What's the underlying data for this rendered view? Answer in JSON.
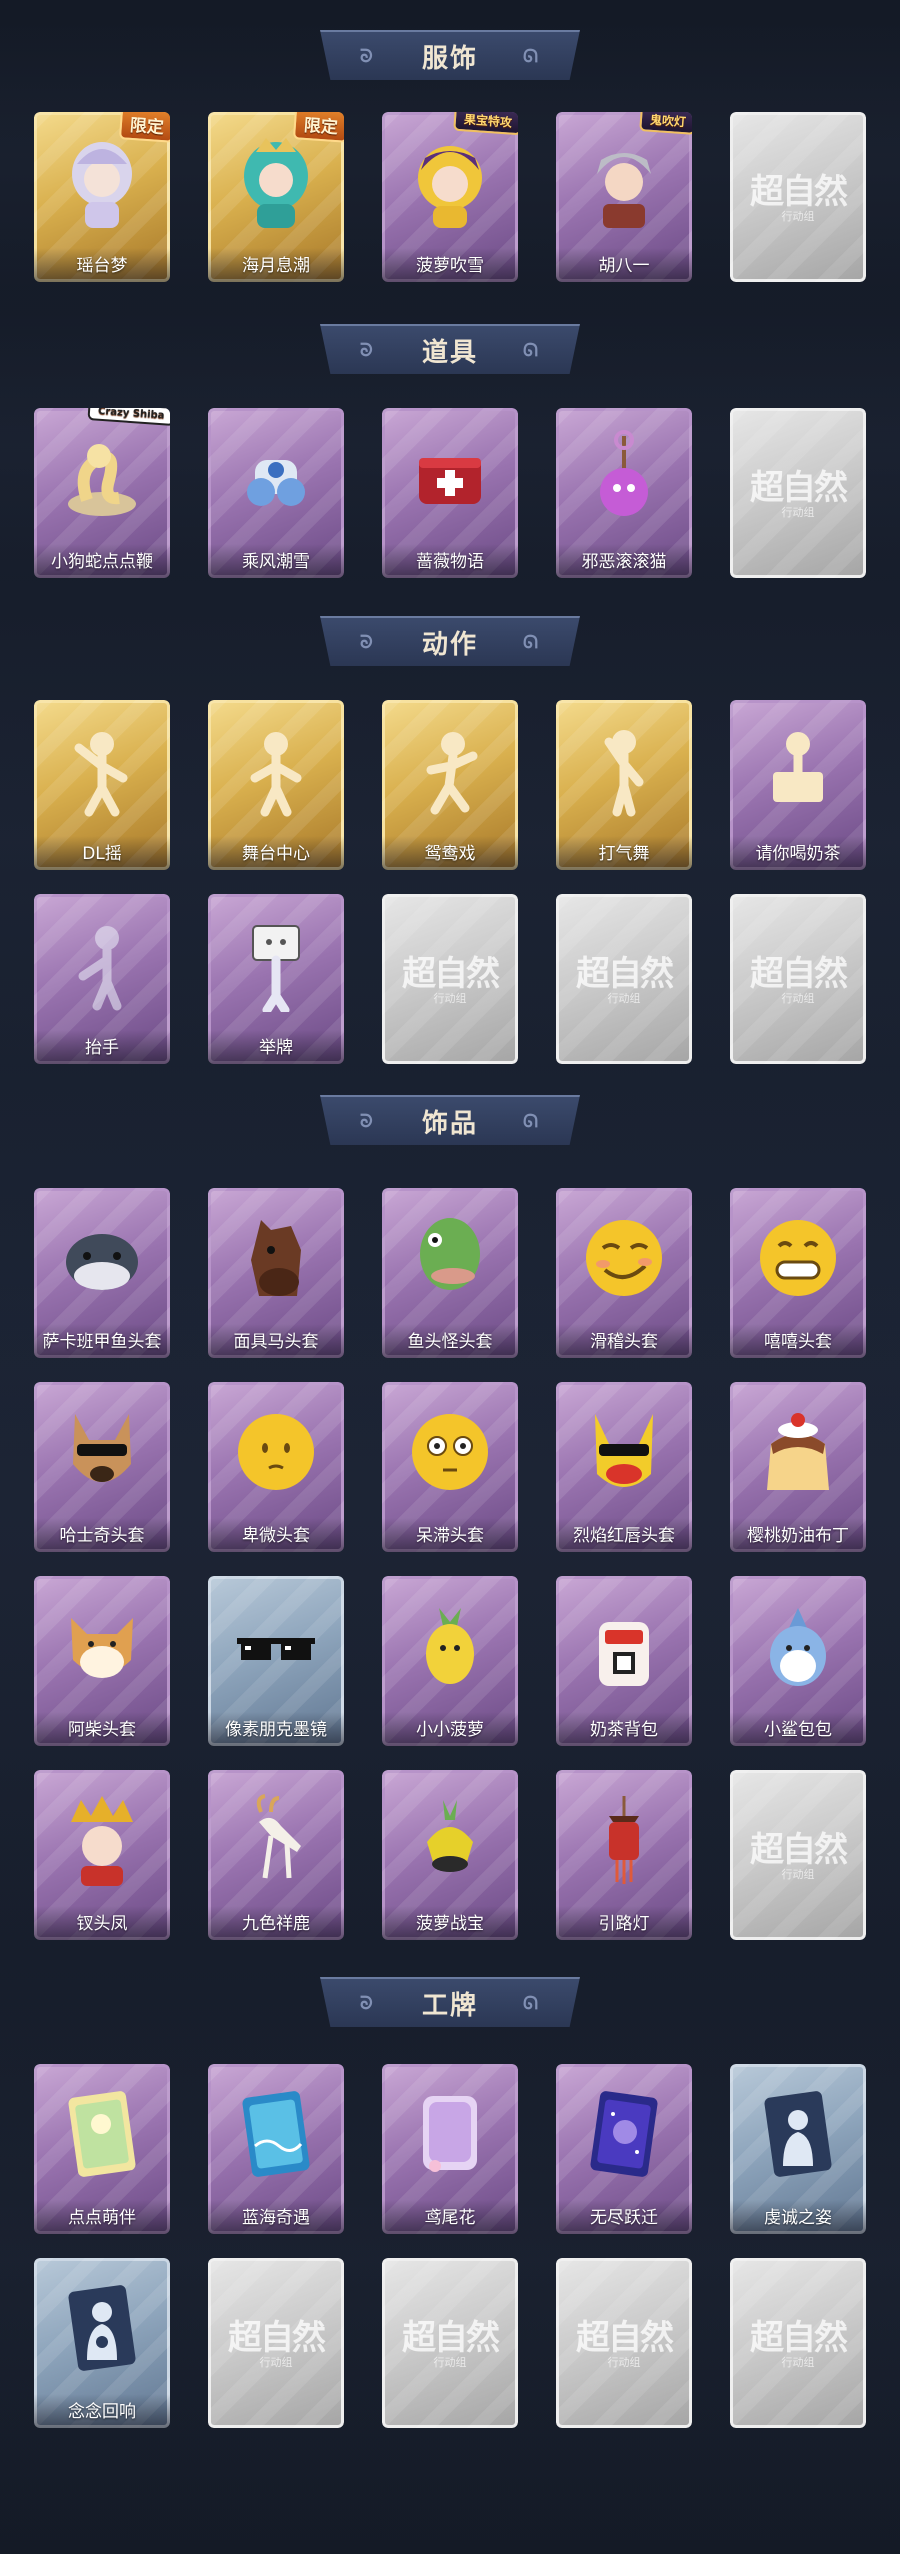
{
  "sections": {
    "costume": {
      "title": "服饰",
      "items": [
        {
          "label": "瑶台梦",
          "badge": "限定"
        },
        {
          "label": "海月息潮",
          "badge": "限定"
        },
        {
          "label": "菠萝吹雪",
          "badge": "果宝特攻"
        },
        {
          "label": "胡八一",
          "badge": "鬼吹灯"
        },
        {
          "label": ""
        }
      ]
    },
    "props": {
      "title": "道具",
      "items": [
        {
          "label": "小狗蛇点点鞭",
          "badge": "Crazy Shiba"
        },
        {
          "label": "乘风潮雪"
        },
        {
          "label": "蔷薇物语"
        },
        {
          "label": "邪恶滚滚猫"
        },
        {
          "label": ""
        }
      ]
    },
    "actions": {
      "title": "动作",
      "items": [
        {
          "label": "DL摇"
        },
        {
          "label": "舞台中心"
        },
        {
          "label": "鸳鸯戏"
        },
        {
          "label": "打气舞"
        },
        {
          "label": "请你喝奶茶"
        },
        {
          "label": "抬手"
        },
        {
          "label": "举牌"
        },
        {
          "label": ""
        },
        {
          "label": ""
        },
        {
          "label": ""
        }
      ]
    },
    "accessories": {
      "title": "饰品",
      "items": [
        {
          "label": "萨卡班甲鱼头套"
        },
        {
          "label": "面具马头套"
        },
        {
          "label": "鱼头怪头套"
        },
        {
          "label": "滑稽头套"
        },
        {
          "label": "嘻嘻头套"
        },
        {
          "label": "哈士奇头套"
        },
        {
          "label": "卑微头套"
        },
        {
          "label": "呆滞头套"
        },
        {
          "label": "烈焰红唇头套"
        },
        {
          "label": "樱桃奶油布丁"
        },
        {
          "label": "阿柴头套"
        },
        {
          "label": "像素朋克墨镜"
        },
        {
          "label": "小小菠萝"
        },
        {
          "label": "奶茶背包"
        },
        {
          "label": "小鲨包包"
        },
        {
          "label": "钗头凤"
        },
        {
          "label": "九色祥鹿"
        },
        {
          "label": "菠萝战宝"
        },
        {
          "label": "引路灯"
        },
        {
          "label": ""
        }
      ]
    },
    "badges": {
      "title": "工牌",
      "items": [
        {
          "label": "点点萌伴"
        },
        {
          "label": "蓝海奇遇"
        },
        {
          "label": "鸢尾花"
        },
        {
          "label": "无尽跃迁"
        },
        {
          "label": "虔诚之姿"
        },
        {
          "label": "念念回响"
        },
        {
          "label": ""
        },
        {
          "label": ""
        },
        {
          "label": ""
        },
        {
          "label": ""
        }
      ]
    }
  },
  "placeholder": {
    "mark": "超自然",
    "sub": "行动组"
  },
  "colors": {
    "gold": "#d9b04e",
    "purple": "#9a74b0",
    "blue": "#8ea5bc",
    "grey": "#c8c8c8"
  }
}
